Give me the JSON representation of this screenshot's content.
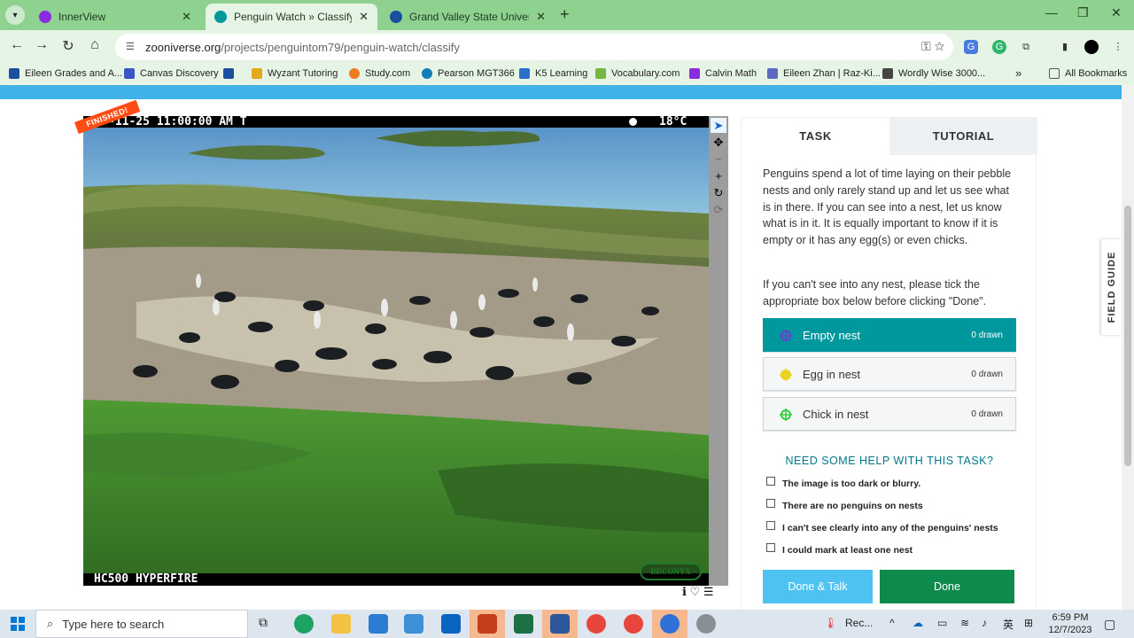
{
  "browser": {
    "tabs": [
      {
        "title": "InnerView",
        "active": false,
        "favicon_color": "#8a2be2"
      },
      {
        "title": "Penguin Watch » Classify — Zo",
        "active": true,
        "favicon_color": "#00979d"
      },
      {
        "title": "Grand Valley State University",
        "active": false,
        "favicon_color": "#1a4fa0"
      }
    ],
    "close_glyph": "✕",
    "new_tab_glyph": "+",
    "window_controls": {
      "minimize": "—",
      "restore": "❐",
      "close": "✕"
    },
    "url_host": "zooniverse.org",
    "url_path": "/projects/penguintom79/penguin-watch/classify",
    "nav": {
      "back": "←",
      "forward": "→",
      "reload": "↻",
      "home": "⌂"
    },
    "omnibox_icons": "⚿  ☆",
    "bookmarks": [
      {
        "label": "Eileen Grades and A...",
        "color": "#1a4fa0"
      },
      {
        "label": "Canvas Discovery",
        "color": "#3a57c4"
      },
      {
        "label": "",
        "color": "#1a4fa0"
      },
      {
        "label": "Wyzant Tutoring",
        "color": "#e3a81b"
      },
      {
        "label": "Study.com",
        "color": "#f07b1f"
      },
      {
        "label": "Pearson MGT366",
        "color": "#0f7fb5"
      },
      {
        "label": "K5 Learning",
        "color": "#2a6fc9"
      },
      {
        "label": "Vocabulary.com",
        "color": "#74b83f"
      },
      {
        "label": "Calvin Math",
        "color": "#8a2be2"
      },
      {
        "label": "Eileen Zhan | Raz-Ki...",
        "color": "#5c6bc0"
      },
      {
        "label": "Wordly Wise 3000...",
        "color": "#444444"
      }
    ],
    "bookmarks_more": "»",
    "all_bookmarks": "All Bookmarks"
  },
  "image": {
    "timestamp": "-11-25 11:00:00 AM  T",
    "temperature": "18°C",
    "camera_label": "HC500 HYPERFIRE",
    "brand": "RECONYX",
    "ribbon": "FINISHED!"
  },
  "image_tools": {
    "pointer": "➤",
    "move": "✥",
    "zoom_out": "−",
    "zoom_in": "+",
    "rotate": "↻",
    "reset": "⟳"
  },
  "meta_icons": "ℹ ♡ ☰",
  "task_panel": {
    "tab_task": "TASK",
    "tab_tutorial": "TUTORIAL",
    "instructions_1": "Penguins spend a lot of time laying on their pebble nests and only rarely stand up and let us see what is in there. If you can see into a nest, let us know what is in it. It is equally important to know if it is empty or it has any egg(s) or even chicks.",
    "instructions_2": "If you can't see into any nest, please tick the appropriate box below before clicking \"Done\".",
    "tools": [
      {
        "label": "Empty nest",
        "count": "0 drawn",
        "color": "#6b3fd1"
      },
      {
        "label": "Egg in nest",
        "count": "0 drawn",
        "color": "#e8d31f"
      },
      {
        "label": "Chick in nest",
        "count": "0 drawn",
        "color": "#2fcf3e"
      }
    ],
    "help_heading": "NEED SOME HELP WITH THIS TASK?",
    "checkboxes": [
      "The image is too dark or blurry.",
      "There are no penguins on nests",
      "I can't see clearly into any of the penguins' nests",
      "I could mark at least one nest"
    ],
    "done_talk": "Done & Talk",
    "done": "Done"
  },
  "field_guide": "FIELD GUIDE",
  "taskbar": {
    "search_placeholder": "Type here to search",
    "weather_text": "Rec...",
    "lang": "英",
    "time": "6:59 PM",
    "date": "12/7/2023"
  }
}
